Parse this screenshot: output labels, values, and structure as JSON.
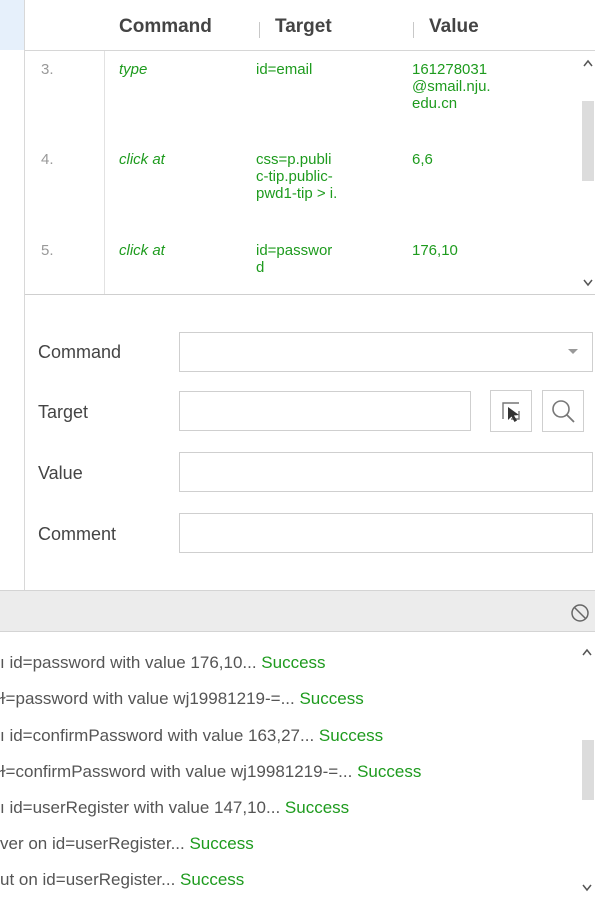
{
  "table": {
    "headers": {
      "command": "Command",
      "target": "Target",
      "value": "Value"
    },
    "rows": [
      {
        "index": "3.",
        "command": "type",
        "target": [
          "id=email"
        ],
        "value": [
          "161278031",
          "@smail.nju.",
          "edu.cn"
        ]
      },
      {
        "index": "4.",
        "command": "click at",
        "target": [
          "css=p.publi",
          "c-tip.public-",
          "pwd1-tip > i."
        ],
        "value": [
          "6,6"
        ]
      },
      {
        "index": "5.",
        "command": "click at",
        "target": [
          "id=passwor",
          "d"
        ],
        "value": [
          "176,10"
        ]
      }
    ]
  },
  "form": {
    "command_label": "Command",
    "target_label": "Target",
    "value_label": "Value",
    "comment_label": "Comment",
    "command_value": "",
    "target_value": "",
    "value_value": "",
    "comment_value": ""
  },
  "log": {
    "lines": [
      {
        "text": "ı id=password with value 176,10... ",
        "status": "Success"
      },
      {
        "text": "ɫ=password with value wj19981219-=... ",
        "status": "Success"
      },
      {
        "text": "ı id=confirmPassword with value 163,27... ",
        "status": "Success"
      },
      {
        "text": "ɫ=confirmPassword with value wj19981219-=... ",
        "status": "Success"
      },
      {
        "text": "ı id=userRegister with value 147,10... ",
        "status": "Success"
      },
      {
        "text": "ver on id=userRegister... ",
        "status": "Success"
      },
      {
        "text": "ut on id=userRegister... ",
        "status": "Success"
      }
    ]
  },
  "colors": {
    "accent_green": "#1e9b1e",
    "selected_bg": "#e6f0fb"
  },
  "icons": [
    "chevron-up-icon",
    "chevron-down-icon",
    "select-target-icon",
    "search-icon",
    "clear-log-icon",
    "dropdown-arrow-icon"
  ]
}
